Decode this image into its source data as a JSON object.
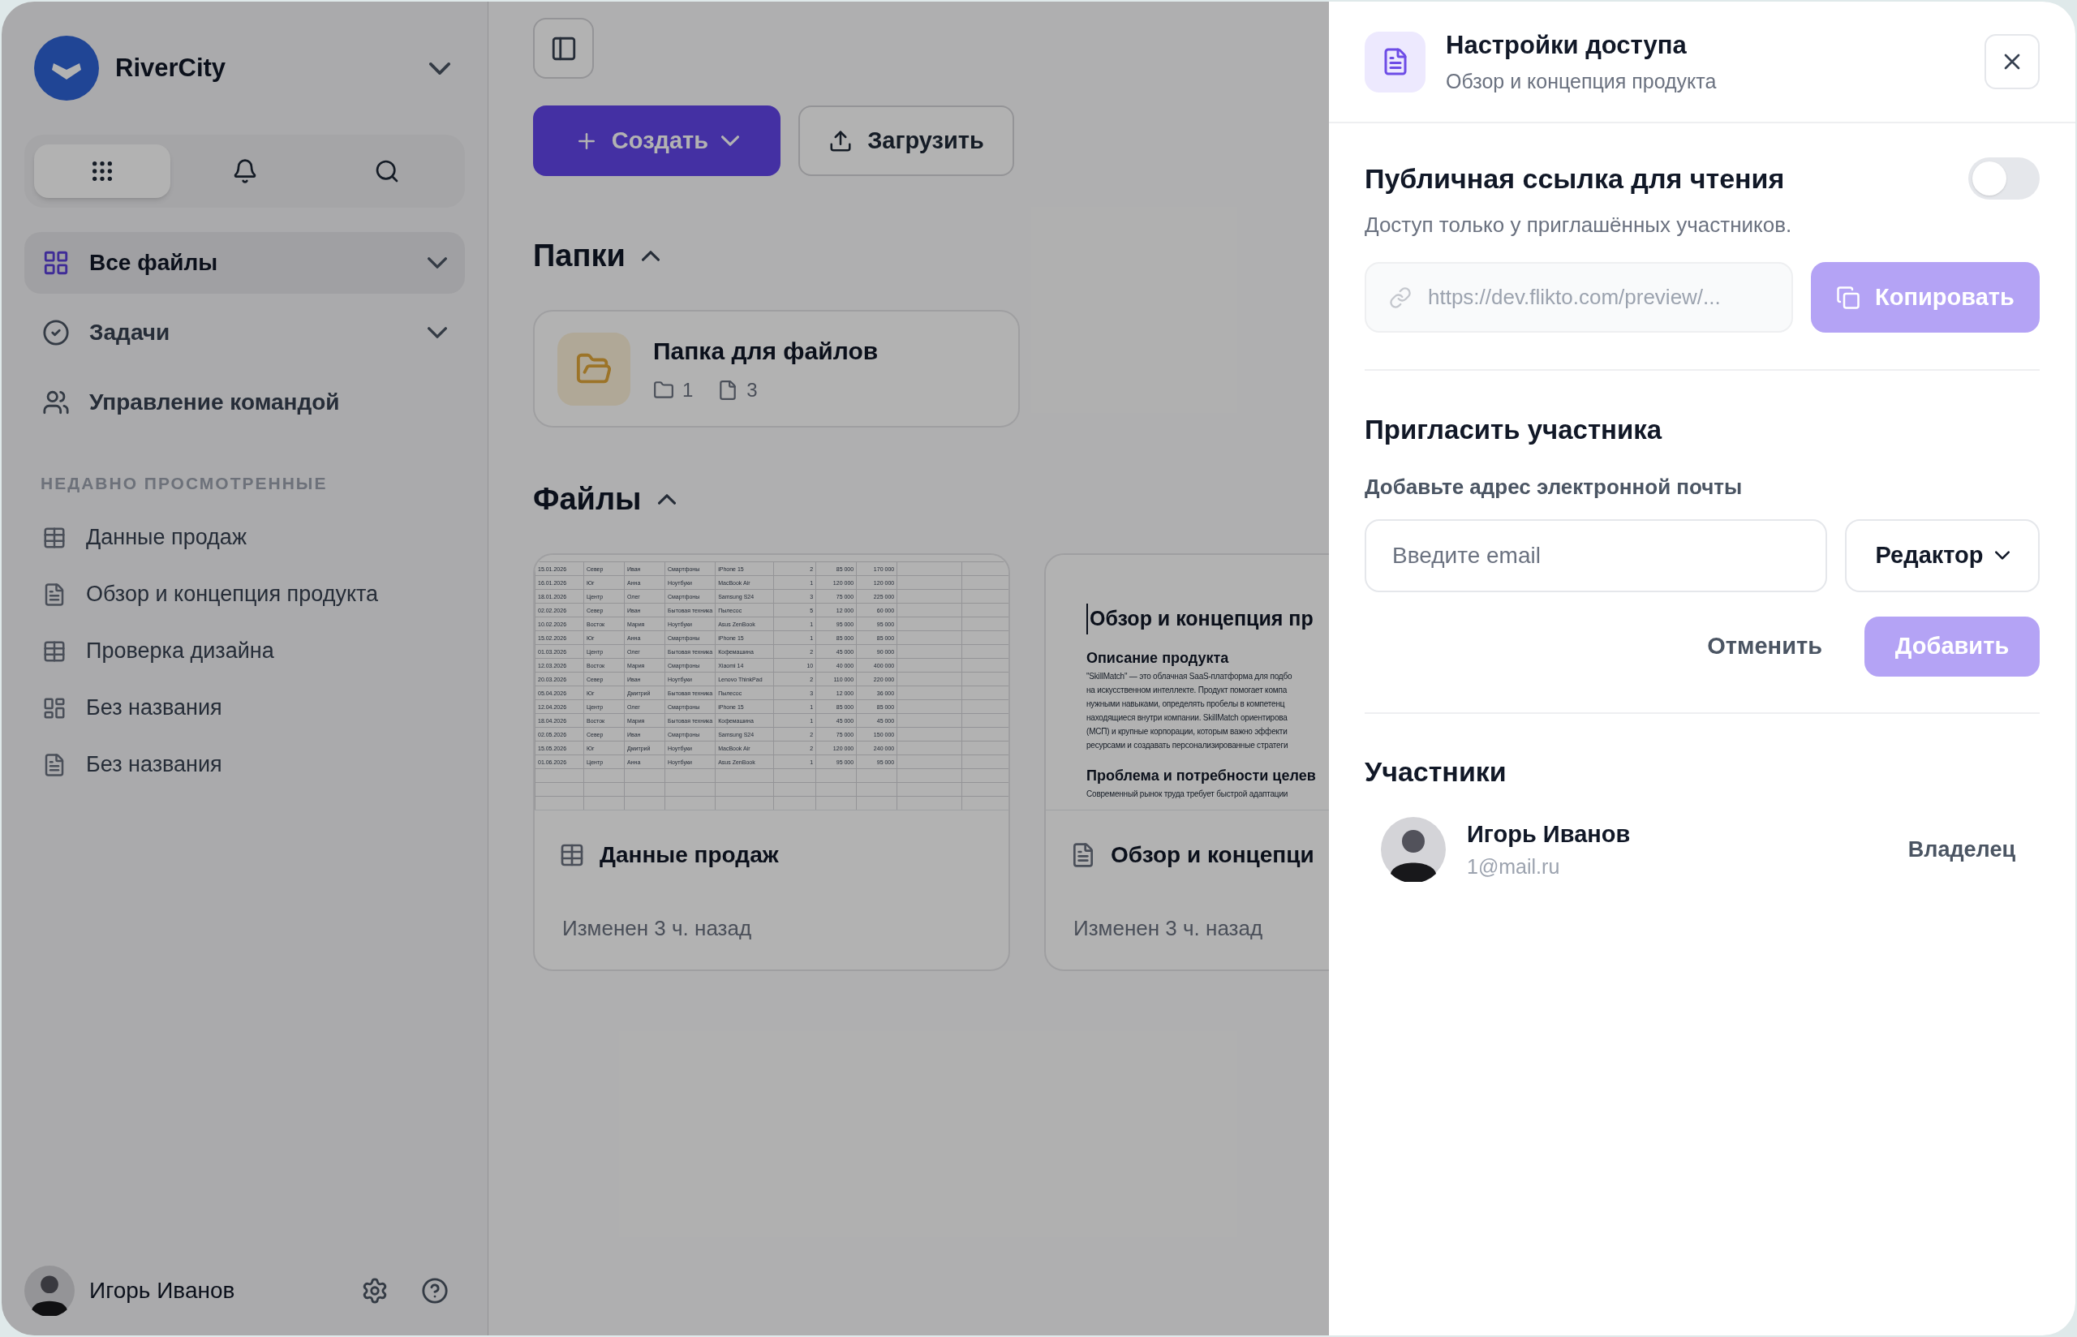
{
  "sidebar": {
    "workspace": {
      "name": "RiverCity"
    },
    "quick_tabs": [
      {
        "kind": "apps",
        "selected": true
      },
      {
        "kind": "notifications",
        "selected": false
      },
      {
        "kind": "search",
        "selected": false
      }
    ],
    "nav": [
      {
        "kind": "files",
        "label": "Все файлы",
        "selected": true,
        "expandable": true
      },
      {
        "kind": "tasks",
        "label": "Задачи",
        "selected": false,
        "expandable": true
      },
      {
        "kind": "team",
        "label": "Управление командой",
        "selected": false,
        "expandable": false
      }
    ],
    "recent": {
      "heading": "НЕДАВНО ПРОСМОТРЕННЫЕ",
      "items": [
        {
          "kind": "table",
          "label": "Данные продаж"
        },
        {
          "kind": "doc",
          "label": "Обзор и концепция продукта"
        },
        {
          "kind": "table",
          "label": "Проверка дизайна"
        },
        {
          "kind": "board",
          "label": "Без названия"
        },
        {
          "kind": "doc",
          "label": "Без названия"
        }
      ]
    },
    "user": {
      "name": "Игорь Иванов"
    }
  },
  "main": {
    "create_button": "Создать",
    "upload_button": "Загрузить",
    "folders": {
      "title": "Папки",
      "expanded": true,
      "items": [
        {
          "name": "Папка для файлов",
          "folders": "1",
          "files": "3"
        }
      ]
    },
    "files": {
      "title": "Файлы",
      "expanded": true,
      "items": [
        {
          "kind": "sheet",
          "name": "Данные продаж",
          "modified": "Изменен 3 ч. назад",
          "preview": {
            "rows": [
              [
                "15.01.2026",
                "Север",
                "Иван",
                "Смартфоны",
                "iPhone 15",
                "2",
                "85 000",
                "170 000"
              ],
              [
                "16.01.2026",
                "Юг",
                "Анна",
                "Ноутбуки",
                "MacBook Air",
                "1",
                "120 000",
                "120 000"
              ],
              [
                "18.01.2026",
                "Центр",
                "Олег",
                "Смартфоны",
                "Samsung S24",
                "3",
                "75 000",
                "225 000"
              ],
              [
                "02.02.2026",
                "Север",
                "Иван",
                "Бытовая техника",
                "Пылесос",
                "5",
                "12 000",
                "60 000"
              ],
              [
                "10.02.2026",
                "Восток",
                "Мария",
                "Ноутбуки",
                "Asus ZenBook",
                "1",
                "95 000",
                "95 000"
              ],
              [
                "15.02.2026",
                "Юг",
                "Анна",
                "Смартфоны",
                "iPhone 15",
                "1",
                "85 000",
                "85 000"
              ],
              [
                "01.03.2026",
                "Центр",
                "Олег",
                "Бытовая техника",
                "Кофемашина",
                "2",
                "45 000",
                "90 000"
              ],
              [
                "12.03.2026",
                "Восток",
                "Мария",
                "Смартфоны",
                "Xiaomi 14",
                "10",
                "40 000",
                "400 000"
              ],
              [
                "20.03.2026",
                "Север",
                "Иван",
                "Ноутбуки",
                "Lenovo ThinkPad",
                "2",
                "110 000",
                "220 000"
              ],
              [
                "05.04.2026",
                "Юг",
                "Дмитрий",
                "Бытовая техника",
                "Пылесос",
                "3",
                "12 000",
                "36 000"
              ],
              [
                "12.04.2026",
                "Центр",
                "Олег",
                "Смартфоны",
                "iPhone 15",
                "1",
                "85 000",
                "85 000"
              ],
              [
                "18.04.2026",
                "Восток",
                "Мария",
                "Бытовая техника",
                "Кофемашина",
                "1",
                "45 000",
                "45 000"
              ],
              [
                "02.05.2026",
                "Север",
                "Иван",
                "Смартфоны",
                "Samsung S24",
                "2",
                "75 000",
                "150 000"
              ],
              [
                "15.05.2026",
                "Юг",
                "Дмитрий",
                "Ноутбуки",
                "MacBook Air",
                "2",
                "120 000",
                "240 000"
              ],
              [
                "01.06.2026",
                "Центр",
                "Анна",
                "Ноутбуки",
                "Asus ZenBook",
                "1",
                "95 000",
                "95 000"
              ]
            ]
          }
        },
        {
          "kind": "doc",
          "name": "Обзор и концепци",
          "modified": "Изменен 3 ч. назад",
          "preview": {
            "title": "Обзор и концепция пр",
            "sections": [
              {
                "heading": "Описание продукта",
                "lines": [
                  "\"SkillMatch\" — это облачная SaaS-платформа для подбо",
                  "на искусственном интеллекте. Продукт помогает компа",
                  "нужными навыками, определять пробелы в компетенц",
                  "находящиеся внутри компании. SkillMatch ориентирова",
                  "(МСП) и крупные корпорации, которым важно эффекти",
                  "ресурсами и создавать персонализированные стратеги"
                ]
              },
              {
                "heading": "Проблема и потребности целев",
                "lines": [
                  "Современный рынок труда требует быстрой адаптации"
                ]
              }
            ]
          }
        }
      ]
    }
  },
  "panel": {
    "title": "Настройки доступа",
    "subtitle": "Обзор и концепция продукта",
    "public_link": {
      "title": "Публичная ссылка для чтения",
      "on": false,
      "description": "Доступ только у приглашённых участников.",
      "url": "https://dev.flikto.com/preview/...",
      "copy_button": {
        "label": "Копировать",
        "disabled": true
      }
    },
    "invite": {
      "title": "Пригласить участника",
      "label": "Добавьте адрес электронной почты",
      "placeholder": "Введите email",
      "role": "Редактор",
      "cancel": "Отменить",
      "add_button": {
        "label": "Добавить",
        "disabled": true
      }
    },
    "members": {
      "title": "Участники",
      "items": [
        {
          "name": "Игорь Иванов",
          "email": "1@mail.ru",
          "role": "Владелец"
        }
      ]
    }
  }
}
